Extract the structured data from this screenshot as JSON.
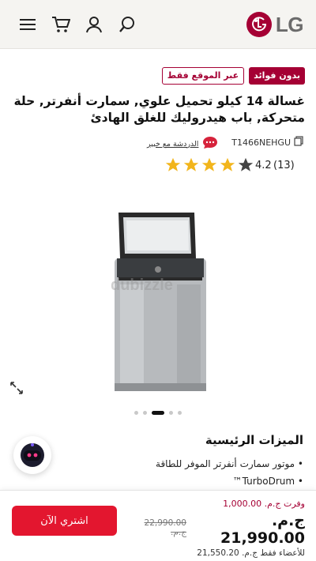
{
  "header": {
    "brand": "LG",
    "icons": [
      "menu-icon",
      "cart-icon",
      "user-icon",
      "search-icon"
    ]
  },
  "badges": {
    "no_interest": "بدون فوائد",
    "online_only": "عبر الموقع فقط"
  },
  "product": {
    "title": "غسالة 14 كيلو تحميل علوي, سمارت أنفرتر, حلة متحركة, باب هيدروليك للغلق الهادئ",
    "model": "T1466NEHGU",
    "chat_expert": "الدردشة مع خبير",
    "rating": "4.2",
    "rating_count": "(13)",
    "rating_value": 4.2,
    "watermark": "dubizzle",
    "gallery_total": 5,
    "gallery_active": 3
  },
  "features": {
    "title": "الميزات الرئيسية",
    "items": [
      "موتور سمارت أنفرتر الموفر للطاقة",
      "TurboDrum™"
    ]
  },
  "purchase": {
    "save_label": "وفرت ج.م. 1,000.00",
    "price": "21,990.00",
    "currency": "ج.م.",
    "old_price": "22,990.00 ج.م.",
    "members": "للأعضاء فقط ج.م. 21,550.20",
    "buy_label": "اشتري الآن"
  },
  "colors": {
    "brand": "#a50034",
    "buy": "#e3162f",
    "star": "#f2b51c"
  }
}
